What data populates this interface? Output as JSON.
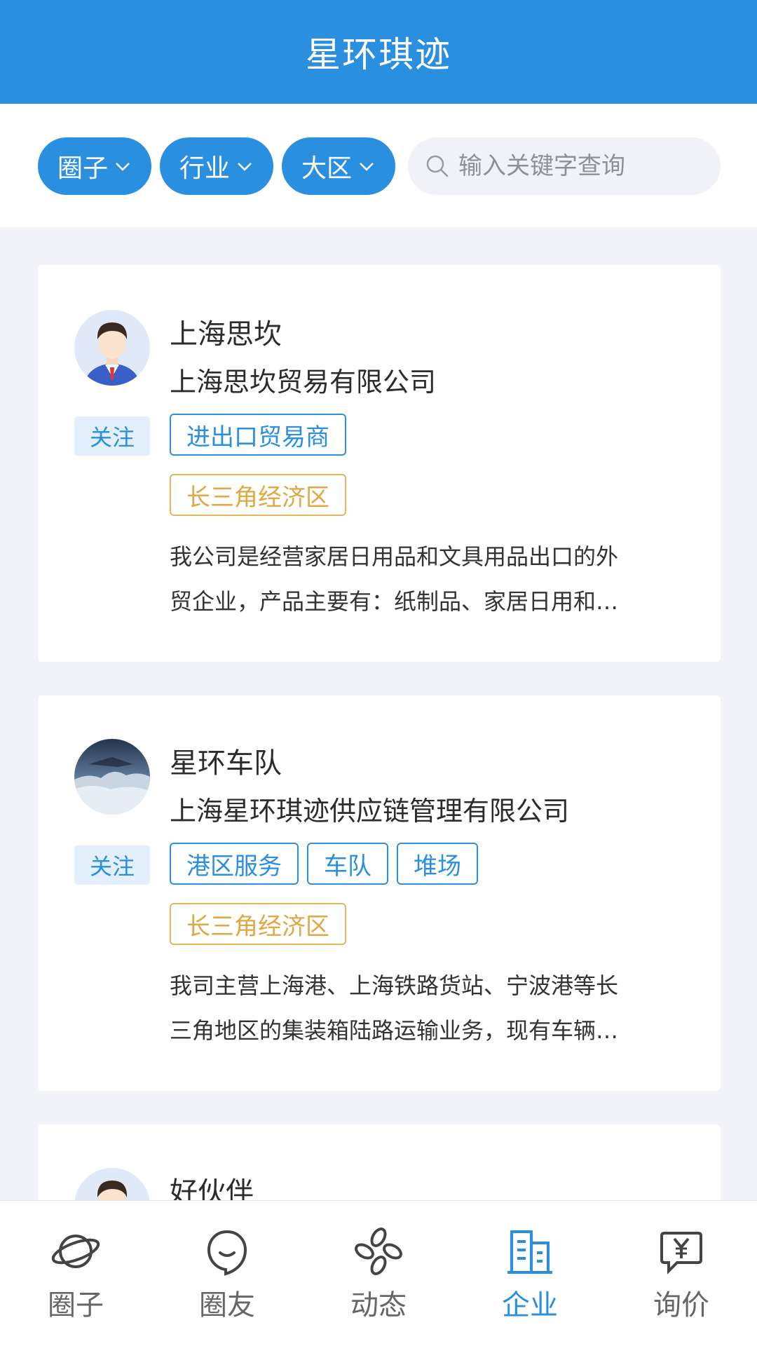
{
  "header": {
    "title": "星环琪迹"
  },
  "filters": [
    {
      "label": "圈子"
    },
    {
      "label": "行业"
    },
    {
      "label": "大区"
    }
  ],
  "search": {
    "placeholder": "输入关键字查询",
    "value": ""
  },
  "cards": [
    {
      "name": "上海思坎",
      "company": "上海思坎贸易有限公司",
      "follow_label": "关注",
      "tags": [
        "进出口贸易商"
      ],
      "region": "长三角经济区",
      "desc_line1": "我公司是经营家居日用品和文具用品出口的外",
      "desc_line2": "贸企业，产品主要有：纸制品、家居日用和…"
    },
    {
      "name": "星环车队",
      "company": "上海星环琪迹供应链管理有限公司",
      "follow_label": "关注",
      "tags": [
        "港区服务",
        "车队",
        "堆场"
      ],
      "region": "长三角经济区",
      "desc_line1": "我司主营上海港、上海铁路货站、宁波港等长",
      "desc_line2": "三角地区的集装箱陆路运输业务，现有车辆…"
    },
    {
      "name": "好伙伴"
    }
  ],
  "tabbar": {
    "items": [
      {
        "label": "圈子",
        "icon": "planet-icon"
      },
      {
        "label": "圈友",
        "icon": "smile-bubble-icon"
      },
      {
        "label": "动态",
        "icon": "pinwheel-icon"
      },
      {
        "label": "企业",
        "icon": "building-icon"
      },
      {
        "label": "询价",
        "icon": "yen-bubble-icon"
      }
    ],
    "active": "企业"
  },
  "colors": {
    "primary": "#2b8fe0",
    "region_tag": "#e0a844",
    "background": "#f2f4f9"
  }
}
